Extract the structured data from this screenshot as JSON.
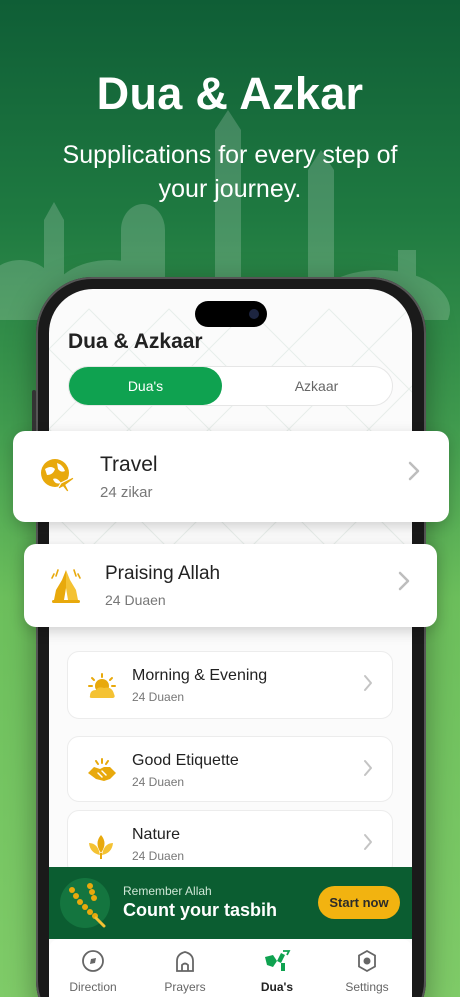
{
  "hero": {
    "title": "Dua & Azkar",
    "subtitle": "Supplications for every step of your journey."
  },
  "screen": {
    "title": "Dua & Azkaar",
    "segments": {
      "active": "Dua's",
      "inactive": "Azkaar"
    }
  },
  "categories": [
    {
      "title": "Travel",
      "count": "24 zikar",
      "icon": "globe-plane-icon"
    },
    {
      "title": "Praising Allah",
      "count": "24 Duaen",
      "icon": "praying-hands-icon"
    },
    {
      "title": "Morning & Evening",
      "count": "24 Duaen",
      "icon": "sun-cloud-icon"
    },
    {
      "title": "Good Etiquette",
      "count": "24 Duaen",
      "icon": "handshake-icon"
    },
    {
      "title": "Nature",
      "count": "24 Duaen",
      "icon": "leaf-icon"
    }
  ],
  "banner": {
    "pre": "Remember Allah",
    "main": "Count your tasbih",
    "button": "Start now"
  },
  "tabs": [
    {
      "label": "Direction",
      "icon": "compass-icon"
    },
    {
      "label": "Prayers",
      "icon": "mosque-icon"
    },
    {
      "label": "Dua's",
      "icon": "dua-icon",
      "active": true
    },
    {
      "label": "Settings",
      "icon": "gear-icon"
    }
  ],
  "colors": {
    "brand_green": "#0fa250",
    "banner_green": "#0b5d31",
    "accent_gold": "#f2b310",
    "icon_gold": "#e8a90c"
  }
}
